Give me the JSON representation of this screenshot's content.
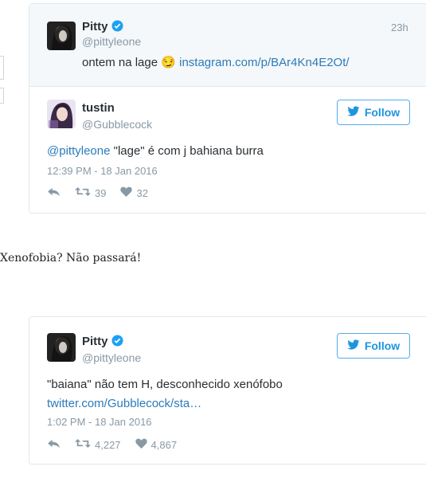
{
  "quoted_tweet": {
    "name": "Pitty",
    "handle": "@pittyleone",
    "time": "23h",
    "text": "ontem na lage",
    "emoji": "😏",
    "link": "instagram.com/p/BAr4Kn4E2Ot/"
  },
  "reply_tweet": {
    "name": "tustin",
    "handle": "@Gubblecock",
    "follow_label": "Follow",
    "mention": "@pittyleone",
    "text": " \"lage\" é com j bahiana burra",
    "timestamp": "12:39 PM - 18 Jan 2016",
    "retweets": "39",
    "likes": "32"
  },
  "caption": "Xenofobia? Não passará!",
  "response_tweet": {
    "name": "Pitty",
    "handle": "@pittyleone",
    "follow_label": "Follow",
    "text": "\"baiana\" não tem H, desconhecido xenófobo",
    "link": "twitter.com/Gubblecock/sta…",
    "timestamp": "1:02 PM - 18 Jan 2016",
    "retweets": "4,227",
    "likes": "4,867"
  },
  "colors": {
    "link": "#2b7bb9",
    "follow_blue": "#1b95e0",
    "verified": "#1da1f2",
    "muted": "#8899a6"
  }
}
